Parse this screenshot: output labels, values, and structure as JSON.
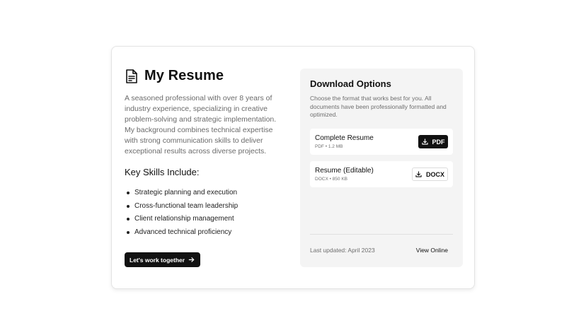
{
  "resume": {
    "title": "My Resume",
    "icon": "document-icon",
    "intro": "A seasoned professional with over 8 years of industry experience, specializing in creative problem-solving and strategic implementation. My background combines technical expertise with strong communication skills to deliver exceptional results across diverse projects.",
    "skills_heading": "Key Skills Include:",
    "skills": [
      "Strategic planning and execution",
      "Cross-functional team leadership",
      "Client relationship management",
      "Advanced technical proficiency"
    ],
    "cta_label": "Let's work together",
    "cta_icon": "arrow-right-icon"
  },
  "download": {
    "title": "Download Options",
    "description": "Choose the format that works best for you. All documents have been professionally formatted and optimized.",
    "files": [
      {
        "name": "Complete Resume",
        "meta": "PDF • 1.2 MB",
        "button_label": "PDF",
        "button_icon": "download-icon"
      },
      {
        "name": "Resume (Editable)",
        "meta": "DOCX • 850 KB",
        "button_label": "DOCX",
        "button_icon": "download-icon"
      }
    ],
    "last_updated": "Last updated: April 2023",
    "view_online_label": "View Online"
  },
  "colors": {
    "primary": "#111111",
    "muted_text": "#6b6b6b",
    "panel_bg": "#f4f4f4"
  }
}
